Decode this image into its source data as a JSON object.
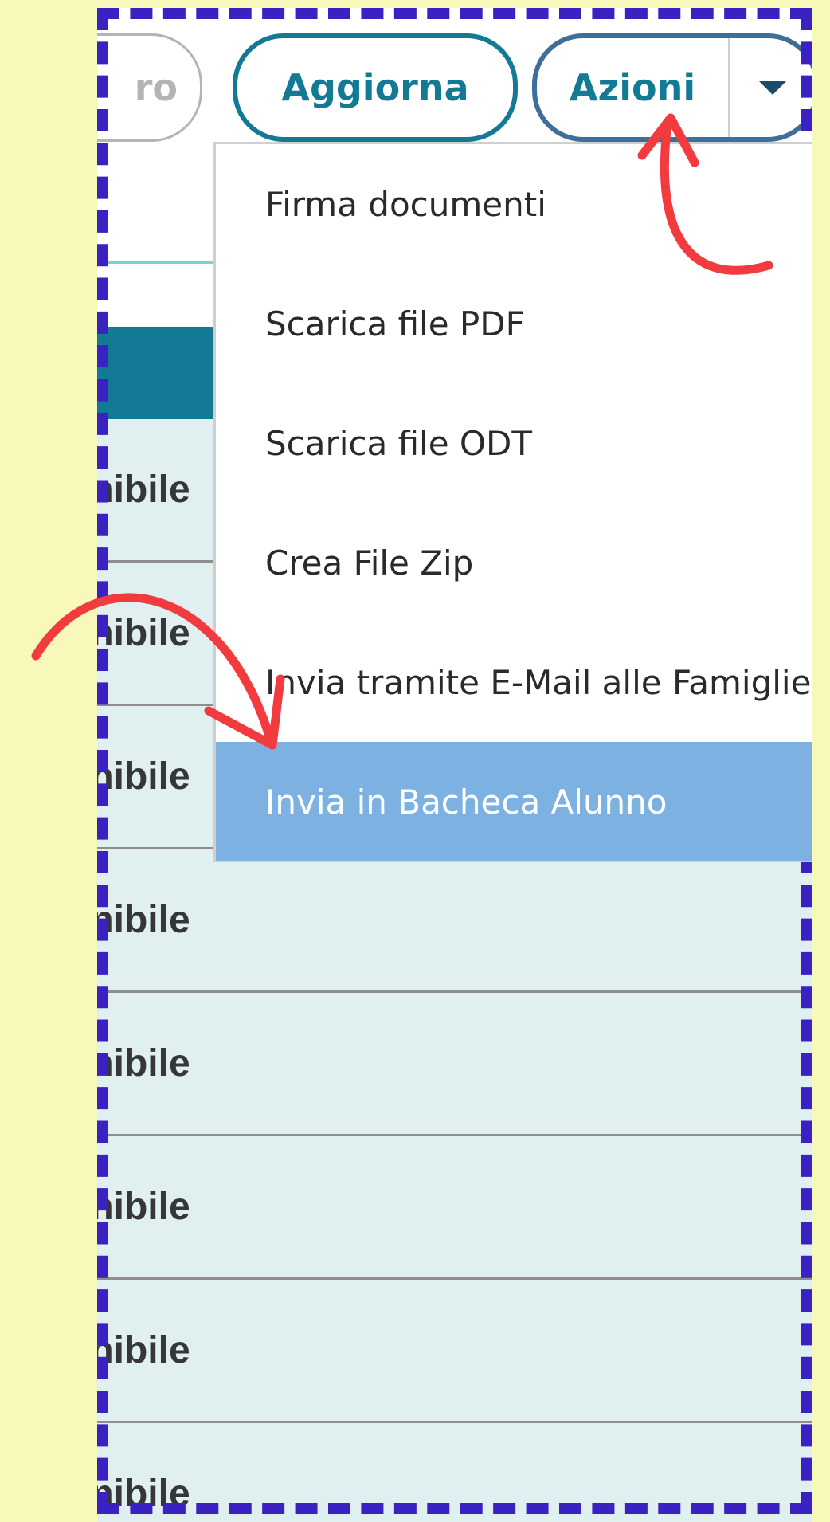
{
  "toolbar": {
    "partial_button_label": "ro",
    "refresh_label": "Aggiorna",
    "actions_label": "Azioni"
  },
  "menu": {
    "items": [
      {
        "label": "Firma documenti"
      },
      {
        "label": "Scarica file PDF"
      },
      {
        "label": "Scarica file ODT"
      },
      {
        "label": "Crea File Zip"
      },
      {
        "label": "Invia tramite E-Mail alle Famiglie"
      },
      {
        "label": "Invia in Bacheca Alunno"
      }
    ],
    "highlighted_index": 5
  },
  "table": {
    "rows": [
      {
        "status": "onibile"
      },
      {
        "status": "onibile"
      },
      {
        "status": "onibile"
      },
      {
        "status": "onibile"
      },
      {
        "status": "onibile"
      },
      {
        "status": "onibile"
      },
      {
        "status": "onibile"
      },
      {
        "status": "onibile"
      }
    ]
  },
  "colors": {
    "background": "#f8f8ba",
    "frame_border": "#3a22c2",
    "accent": "#137a96",
    "highlight": "#7db1e2",
    "row_bg": "#e0eff0",
    "arrow": "#f23b3f"
  },
  "icons": {
    "dropdown": "caret-down-icon",
    "annotation": "red-arrow-icon"
  }
}
